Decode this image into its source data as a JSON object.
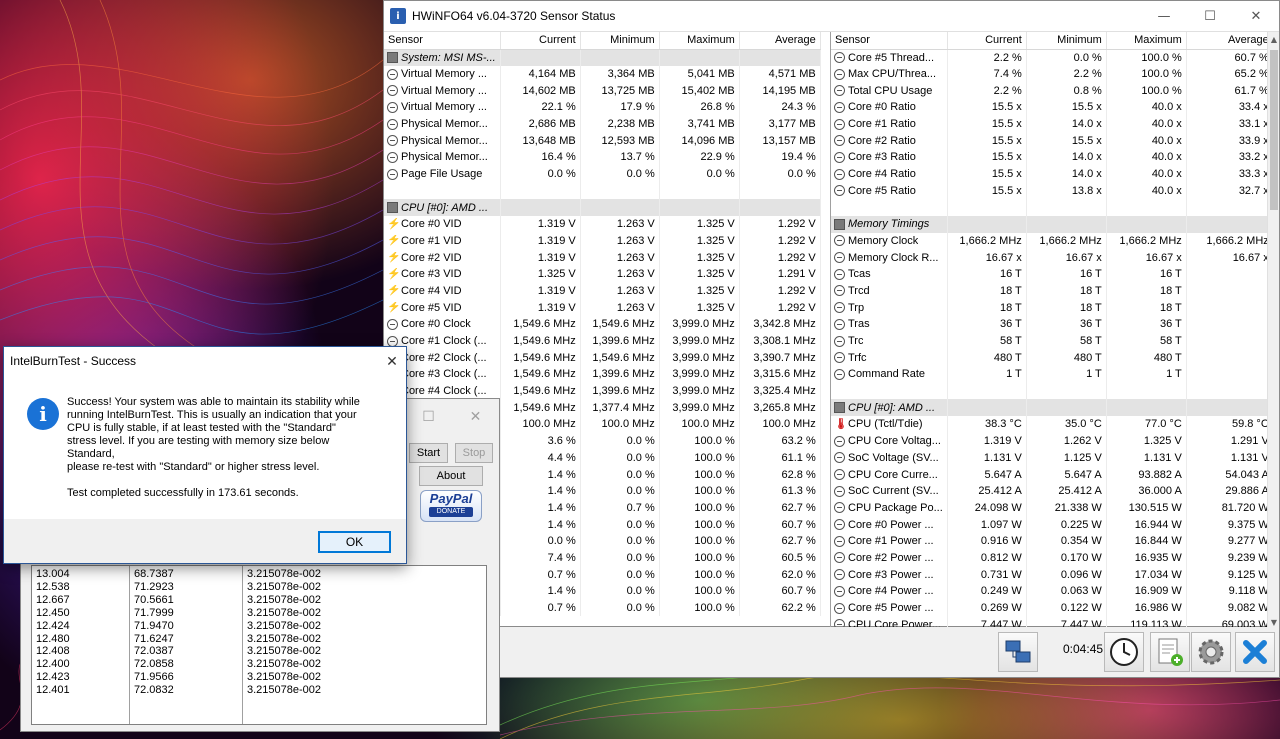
{
  "hwinfo": {
    "title": "HWiNFO64 v6.04-3720 Sensor Status",
    "window_controls": {
      "minimize": "—",
      "maximize": "☐",
      "close": "✕"
    },
    "columns": [
      "Sensor",
      "Current",
      "Minimum",
      "Maximum",
      "Average"
    ],
    "left_rows": [
      {
        "t": "g",
        "name": "System: MSI MS-..."
      },
      {
        "t": "c",
        "name": "Virtual Memory ...",
        "cur": "4,164 MB",
        "min": "3,364 MB",
        "max": "5,041 MB",
        "avg": "4,571 MB"
      },
      {
        "t": "c",
        "name": "Virtual Memory ...",
        "cur": "14,602 MB",
        "min": "13,725 MB",
        "max": "15,402 MB",
        "avg": "14,195 MB"
      },
      {
        "t": "c",
        "name": "Virtual Memory ...",
        "cur": "22.1 %",
        "min": "17.9 %",
        "max": "26.8 %",
        "avg": "24.3 %"
      },
      {
        "t": "c",
        "name": "Physical Memor...",
        "cur": "2,686 MB",
        "min": "2,238 MB",
        "max": "3,741 MB",
        "avg": "3,177 MB"
      },
      {
        "t": "c",
        "name": "Physical Memor...",
        "cur": "13,648 MB",
        "min": "12,593 MB",
        "max": "14,096 MB",
        "avg": "13,157 MB"
      },
      {
        "t": "c",
        "name": "Physical Memor...",
        "cur": "16.4 %",
        "min": "13.7 %",
        "max": "22.9 %",
        "avg": "19.4 %"
      },
      {
        "t": "c",
        "name": "Page File Usage",
        "cur": "0.0 %",
        "min": "0.0 %",
        "max": "0.0 %",
        "avg": "0.0 %"
      },
      {
        "t": "b"
      },
      {
        "t": "g",
        "name": "CPU [#0]: AMD ..."
      },
      {
        "t": "v",
        "name": "Core #0 VID",
        "cur": "1.319 V",
        "min": "1.263 V",
        "max": "1.325 V",
        "avg": "1.292 V"
      },
      {
        "t": "v",
        "name": "Core #1 VID",
        "cur": "1.319 V",
        "min": "1.263 V",
        "max": "1.325 V",
        "avg": "1.292 V"
      },
      {
        "t": "v",
        "name": "Core #2 VID",
        "cur": "1.319 V",
        "min": "1.263 V",
        "max": "1.325 V",
        "avg": "1.292 V"
      },
      {
        "t": "v",
        "name": "Core #3 VID",
        "cur": "1.325 V",
        "min": "1.263 V",
        "max": "1.325 V",
        "avg": "1.291 V"
      },
      {
        "t": "v",
        "name": "Core #4 VID",
        "cur": "1.319 V",
        "min": "1.263 V",
        "max": "1.325 V",
        "avg": "1.292 V"
      },
      {
        "t": "v",
        "name": "Core #5 VID",
        "cur": "1.319 V",
        "min": "1.263 V",
        "max": "1.325 V",
        "avg": "1.292 V"
      },
      {
        "t": "c",
        "name": "Core #0 Clock",
        "cur": "1,549.6 MHz",
        "min": "1,549.6 MHz",
        "max": "3,999.0 MHz",
        "avg": "3,342.8 MHz"
      },
      {
        "t": "c",
        "name": "Core #1 Clock (...",
        "cur": "1,549.6 MHz",
        "min": "1,399.6 MHz",
        "max": "3,999.0 MHz",
        "avg": "3,308.1 MHz"
      },
      {
        "t": "c",
        "name": "Core #2 Clock (...",
        "cur": "1,549.6 MHz",
        "min": "1,549.6 MHz",
        "max": "3,999.0 MHz",
        "avg": "3,390.7 MHz"
      },
      {
        "t": "c",
        "name": "Core #3 Clock (...",
        "cur": "1,549.6 MHz",
        "min": "1,399.6 MHz",
        "max": "3,999.0 MHz",
        "avg": "3,315.6 MHz"
      },
      {
        "t": "c",
        "name": "Core #4 Clock (...",
        "cur": "1,549.6 MHz",
        "min": "1,399.6 MHz",
        "max": "3,999.0 MHz",
        "avg": "3,325.4 MHz"
      },
      {
        "t": "c",
        "name": "Core #5 Clock (...",
        "cur": "1,549.6 MHz",
        "min": "1,377.4 MHz",
        "max": "3,999.0 MHz",
        "avg": "3,265.8 MHz"
      },
      {
        "t": "c",
        "name": "",
        "cur": "100.0 MHz",
        "min": "100.0 MHz",
        "max": "100.0 MHz",
        "avg": "100.0 MHz"
      },
      {
        "t": "c",
        "name": "",
        "cur": "3.6 %",
        "min": "0.0 %",
        "max": "100.0 %",
        "avg": "63.2 %"
      },
      {
        "t": "c",
        "name": "",
        "cur": "4.4 %",
        "min": "0.0 %",
        "max": "100.0 %",
        "avg": "61.1 %"
      },
      {
        "t": "c",
        "name": "",
        "cur": "1.4 %",
        "min": "0.0 %",
        "max": "100.0 %",
        "avg": "62.8 %"
      },
      {
        "t": "c",
        "name": "",
        "cur": "1.4 %",
        "min": "0.0 %",
        "max": "100.0 %",
        "avg": "61.3 %"
      },
      {
        "t": "c",
        "name": "",
        "cur": "1.4 %",
        "min": "0.7 %",
        "max": "100.0 %",
        "avg": "62.7 %"
      },
      {
        "t": "c",
        "name": "",
        "cur": "1.4 %",
        "min": "0.0 %",
        "max": "100.0 %",
        "avg": "60.7 %"
      },
      {
        "t": "c",
        "name": "",
        "cur": "0.0 %",
        "min": "0.0 %",
        "max": "100.0 %",
        "avg": "62.7 %"
      },
      {
        "t": "c",
        "name": "",
        "cur": "7.4 %",
        "min": "0.0 %",
        "max": "100.0 %",
        "avg": "60.5 %"
      },
      {
        "t": "c",
        "name": "",
        "cur": "0.7 %",
        "min": "0.0 %",
        "max": "100.0 %",
        "avg": "62.0 %"
      },
      {
        "t": "c",
        "name": "",
        "cur": "1.4 %",
        "min": "0.0 %",
        "max": "100.0 %",
        "avg": "60.7 %"
      },
      {
        "t": "c",
        "name": "",
        "cur": "0.7 %",
        "min": "0.0 %",
        "max": "100.0 %",
        "avg": "62.2 %"
      }
    ],
    "right_rows": [
      {
        "t": "c",
        "name": "Core #5 Thread...",
        "cur": "2.2 %",
        "min": "0.0 %",
        "max": "100.0 %",
        "avg": "60.7 %"
      },
      {
        "t": "c",
        "name": "Max CPU/Threa...",
        "cur": "7.4 %",
        "min": "2.2 %",
        "max": "100.0 %",
        "avg": "65.2 %"
      },
      {
        "t": "c",
        "name": "Total CPU Usage",
        "cur": "2.2 %",
        "min": "0.8 %",
        "max": "100.0 %",
        "avg": "61.7 %"
      },
      {
        "t": "c",
        "name": "Core #0 Ratio",
        "cur": "15.5 x",
        "min": "15.5 x",
        "max": "40.0 x",
        "avg": "33.4 x"
      },
      {
        "t": "c",
        "name": "Core #1 Ratio",
        "cur": "15.5 x",
        "min": "14.0 x",
        "max": "40.0 x",
        "avg": "33.1 x"
      },
      {
        "t": "c",
        "name": "Core #2 Ratio",
        "cur": "15.5 x",
        "min": "15.5 x",
        "max": "40.0 x",
        "avg": "33.9 x"
      },
      {
        "t": "c",
        "name": "Core #3 Ratio",
        "cur": "15.5 x",
        "min": "14.0 x",
        "max": "40.0 x",
        "avg": "33.2 x"
      },
      {
        "t": "c",
        "name": "Core #4 Ratio",
        "cur": "15.5 x",
        "min": "14.0 x",
        "max": "40.0 x",
        "avg": "33.3 x"
      },
      {
        "t": "c",
        "name": "Core #5 Ratio",
        "cur": "15.5 x",
        "min": "13.8 x",
        "max": "40.0 x",
        "avg": "32.7 x"
      },
      {
        "t": "b"
      },
      {
        "t": "g",
        "name": "Memory Timings"
      },
      {
        "t": "c",
        "name": "Memory Clock",
        "cur": "1,666.2 MHz",
        "min": "1,666.2 MHz",
        "max": "1,666.2 MHz",
        "avg": "1,666.2 MHz"
      },
      {
        "t": "c",
        "name": "Memory Clock R...",
        "cur": "16.67 x",
        "min": "16.67 x",
        "max": "16.67 x",
        "avg": "16.67 x"
      },
      {
        "t": "c",
        "name": "Tcas",
        "cur": "16 T",
        "min": "16 T",
        "max": "16 T",
        "avg": ""
      },
      {
        "t": "c",
        "name": "Trcd",
        "cur": "18 T",
        "min": "18 T",
        "max": "18 T",
        "avg": ""
      },
      {
        "t": "c",
        "name": "Trp",
        "cur": "18 T",
        "min": "18 T",
        "max": "18 T",
        "avg": ""
      },
      {
        "t": "c",
        "name": "Tras",
        "cur": "36 T",
        "min": "36 T",
        "max": "36 T",
        "avg": ""
      },
      {
        "t": "c",
        "name": "Trc",
        "cur": "58 T",
        "min": "58 T",
        "max": "58 T",
        "avg": ""
      },
      {
        "t": "c",
        "name": "Trfc",
        "cur": "480 T",
        "min": "480 T",
        "max": "480 T",
        "avg": ""
      },
      {
        "t": "c",
        "name": "Command Rate",
        "cur": "1 T",
        "min": "1 T",
        "max": "1 T",
        "avg": ""
      },
      {
        "t": "b"
      },
      {
        "t": "g",
        "name": "CPU [#0]: AMD ..."
      },
      {
        "t": "t",
        "name": "CPU (Tctl/Tdie)",
        "cur": "38.3 °C",
        "min": "35.0 °C",
        "max": "77.0 °C",
        "avg": "59.8 °C"
      },
      {
        "t": "c",
        "name": "CPU Core Voltag...",
        "cur": "1.319 V",
        "min": "1.262 V",
        "max": "1.325 V",
        "avg": "1.291 V"
      },
      {
        "t": "c",
        "name": "SoC Voltage (SV...",
        "cur": "1.131 V",
        "min": "1.125 V",
        "max": "1.131 V",
        "avg": "1.131 V"
      },
      {
        "t": "c",
        "name": "CPU Core Curre...",
        "cur": "5.647 A",
        "min": "5.647 A",
        "max": "93.882 A",
        "avg": "54.043 A"
      },
      {
        "t": "c",
        "name": "SoC Current (SV...",
        "cur": "25.412 A",
        "min": "25.412 A",
        "max": "36.000 A",
        "avg": "29.886 A"
      },
      {
        "t": "c",
        "name": "CPU Package Po...",
        "cur": "24.098 W",
        "min": "21.338 W",
        "max": "130.515 W",
        "avg": "81.720 W"
      },
      {
        "t": "c",
        "name": "Core #0 Power ...",
        "cur": "1.097 W",
        "min": "0.225 W",
        "max": "16.944 W",
        "avg": "9.375 W"
      },
      {
        "t": "c",
        "name": "Core #1 Power ...",
        "cur": "0.916 W",
        "min": "0.354 W",
        "max": "16.844 W",
        "avg": "9.277 W"
      },
      {
        "t": "c",
        "name": "Core #2 Power ...",
        "cur": "0.812 W",
        "min": "0.170 W",
        "max": "16.935 W",
        "avg": "9.239 W"
      },
      {
        "t": "c",
        "name": "Core #3 Power ...",
        "cur": "0.731 W",
        "min": "0.096 W",
        "max": "17.034 W",
        "avg": "9.125 W"
      },
      {
        "t": "c",
        "name": "Core #4 Power ...",
        "cur": "0.249 W",
        "min": "0.063 W",
        "max": "16.909 W",
        "avg": "9.118 W"
      },
      {
        "t": "c",
        "name": "Core #5 Power ...",
        "cur": "0.269 W",
        "min": "0.122 W",
        "max": "16.986 W",
        "avg": "9.082 W"
      },
      {
        "t": "c",
        "name": "CPU Core Power...",
        "cur": "7.447 W",
        "min": "7.447 W",
        "max": "119.113 W",
        "avg": "69.003 W"
      }
    ],
    "toolbar": {
      "elapsed": "0:04:45",
      "icons": [
        "network-icon",
        "clock-icon",
        "report-icon",
        "settings-icon",
        "close-icon"
      ]
    }
  },
  "ibt": {
    "start_label": "Start",
    "stop_label": "Stop",
    "about_label": "About",
    "paypal_text": "PayPal",
    "donate_text": "DONATE",
    "results": [
      [
        "13.004",
        "68.7387",
        "3.215078e-002"
      ],
      [
        "12.538",
        "71.2923",
        "3.215078e-002"
      ],
      [
        "12.667",
        "70.5661",
        "3.215078e-002"
      ],
      [
        "12.450",
        "71.7999",
        "3.215078e-002"
      ],
      [
        "12.424",
        "71.9470",
        "3.215078e-002"
      ],
      [
        "12.480",
        "71.6247",
        "3.215078e-002"
      ],
      [
        "12.408",
        "72.0387",
        "3.215078e-002"
      ],
      [
        "12.400",
        "72.0858",
        "3.215078e-002"
      ],
      [
        "12.423",
        "71.9566",
        "3.215078e-002"
      ],
      [
        "12.401",
        "72.0832",
        "3.215078e-002"
      ]
    ]
  },
  "dialog": {
    "title": "IntelBurnTest - Success",
    "close": "✕",
    "icon": "info-icon",
    "message": "Success! Your system was able to maintain its stability while\nrunning IntelBurnTest. This is usually an indication that your\nCPU is fully stable, if at least tested with the \"Standard\"\nstress level. If you are testing with memory size below\nStandard,\nplease re-test with \"Standard\" or higher stress level.",
    "completion": "Test completed successfully in 173.61 seconds.",
    "ok_label": "OK"
  }
}
